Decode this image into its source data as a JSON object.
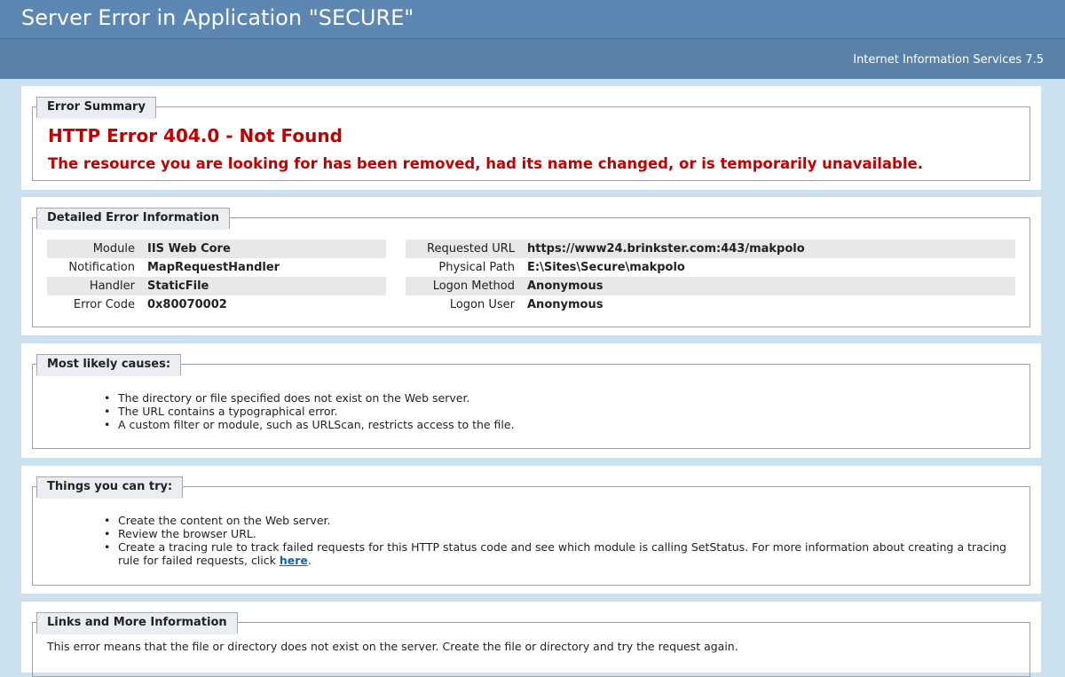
{
  "header": {
    "title": "Server Error in Application \"SECURE\""
  },
  "subheader": {
    "server": "Internet Information Services 7.5"
  },
  "summary": {
    "legend": "Error Summary",
    "title": "HTTP Error 404.0 - Not Found",
    "message": "The resource you are looking for has been removed, had its name changed, or is temporarily unavailable."
  },
  "details": {
    "legend": "Detailed Error Information",
    "left": [
      {
        "label": "Module",
        "value": "IIS Web Core"
      },
      {
        "label": "Notification",
        "value": "MapRequestHandler"
      },
      {
        "label": "Handler",
        "value": "StaticFile"
      },
      {
        "label": "Error Code",
        "value": "0x80070002"
      }
    ],
    "right": [
      {
        "label": "Requested URL",
        "value": "https://www24.brinkster.com:443/makpolo"
      },
      {
        "label": "Physical Path",
        "value": "E:\\Sites\\Secure\\makpolo"
      },
      {
        "label": "Logon Method",
        "value": "Anonymous"
      },
      {
        "label": "Logon User",
        "value": "Anonymous"
      }
    ]
  },
  "causes": {
    "legend": "Most likely causes:",
    "items": [
      "The directory or file specified does not exist on the Web server.",
      "The URL contains a typographical error.",
      "A custom filter or module, such as URLScan, restricts access to the file."
    ]
  },
  "try": {
    "legend": "Things you can try:",
    "items": [
      "Create the content on the Web server.",
      "Review the browser URL."
    ],
    "tracing_text": "Create a tracing rule to track failed requests for this HTTP status code and see which module is calling SetStatus. For more information about creating a tracing rule for failed requests, click ",
    "tracing_link": "here",
    "tracing_end": "."
  },
  "links": {
    "legend": "Links and More Information",
    "text": "This error means that the file or directory does not exist on the server. Create the file or directory and try the request again."
  }
}
